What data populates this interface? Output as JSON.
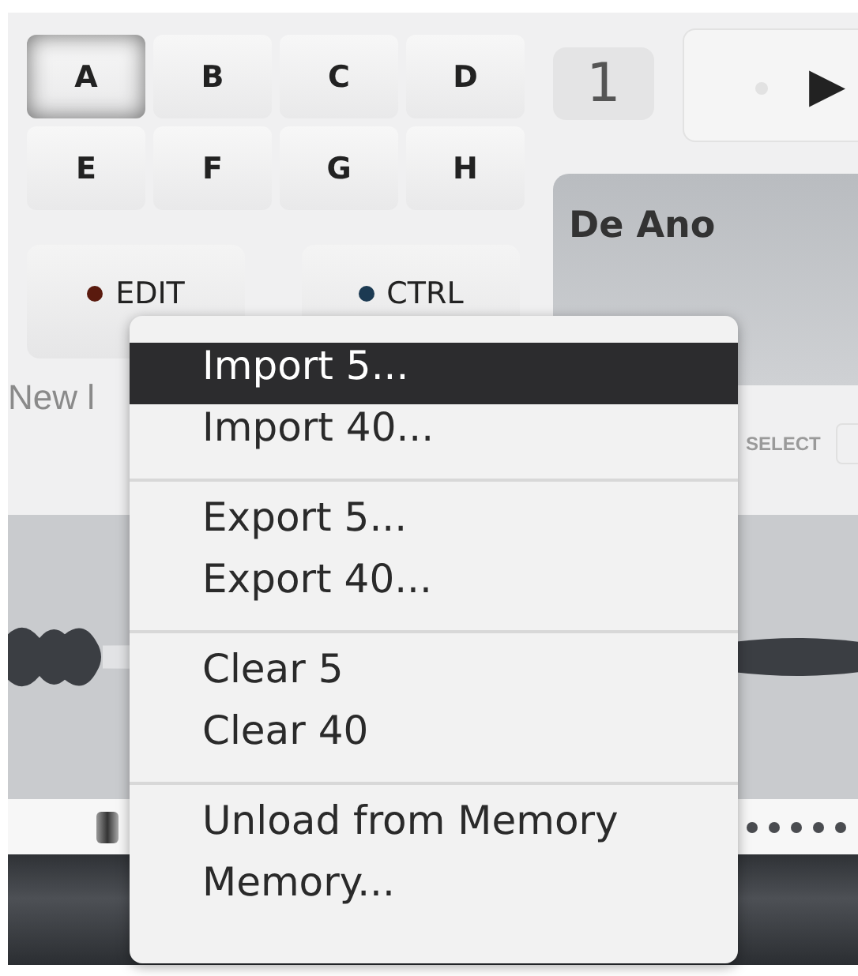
{
  "pads": [
    {
      "label": "A",
      "selected": true
    },
    {
      "label": "B",
      "selected": false
    },
    {
      "label": "C",
      "selected": false
    },
    {
      "label": "D",
      "selected": false
    },
    {
      "label": "E",
      "selected": false
    },
    {
      "label": "F",
      "selected": false
    },
    {
      "label": "G",
      "selected": false
    },
    {
      "label": "H",
      "selected": false
    }
  ],
  "counter": "1",
  "play_symbol": "▶",
  "mode_buttons": [
    {
      "label": "EDIT",
      "color": "#5a1a0e"
    },
    {
      "label": "CTRL",
      "color": "#1c3a52"
    }
  ],
  "name_field": {
    "value": "New l"
  },
  "preset_name": "De Ano",
  "select_label": "SELECT",
  "menu": {
    "groups": [
      [
        {
          "label": "Import 5...",
          "selected": true
        },
        {
          "label": "Import 40...",
          "selected": false
        }
      ],
      [
        {
          "label": "Export 5...",
          "selected": false
        },
        {
          "label": "Export 40...",
          "selected": false
        }
      ],
      [
        {
          "label": "Clear 5",
          "selected": false
        },
        {
          "label": "Clear 40",
          "selected": false
        }
      ],
      [
        {
          "label": "Unload from Memory",
          "selected": false
        },
        {
          "label": "Memory...",
          "selected": false
        }
      ]
    ]
  }
}
